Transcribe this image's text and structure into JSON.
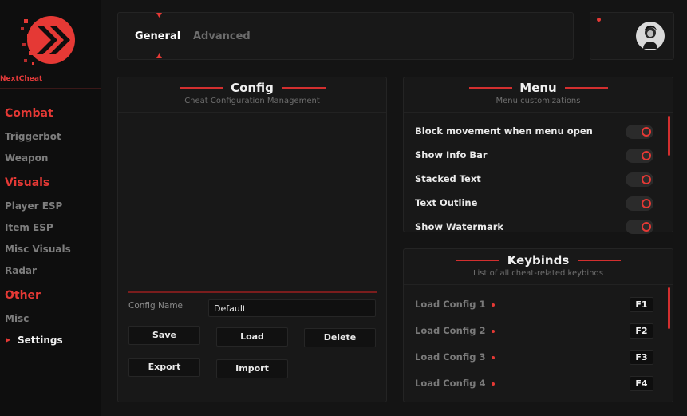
{
  "brand": {
    "name": "NextCheat",
    "accent": "#e53935"
  },
  "sidebar": {
    "sections": [
      {
        "title": "Combat",
        "items": [
          "Triggerbot",
          "Weapon"
        ]
      },
      {
        "title": "Visuals",
        "items": [
          "Player ESP",
          "Item ESP",
          "Misc Visuals",
          "Radar"
        ]
      },
      {
        "title": "Other",
        "items": [
          "Misc",
          "Settings"
        ]
      }
    ],
    "active_item": "Settings"
  },
  "tabs": [
    {
      "label": "General",
      "active": true
    },
    {
      "label": "Advanced",
      "active": false
    }
  ],
  "config": {
    "title": "Config",
    "subtitle": "Cheat Configuration Management",
    "name_label": "Config Name",
    "name_value": "Default",
    "buttons": {
      "save": "Save",
      "load": "Load",
      "delete": "Delete",
      "export": "Export",
      "import": "Import"
    }
  },
  "menu": {
    "title": "Menu",
    "subtitle": "Menu customizations",
    "options": [
      {
        "label": "Block movement when menu open",
        "enabled": false
      },
      {
        "label": "Show Info Bar",
        "enabled": false
      },
      {
        "label": "Stacked Text",
        "enabled": false
      },
      {
        "label": "Text Outline",
        "enabled": false
      },
      {
        "label": "Show Watermark",
        "enabled": false
      }
    ]
  },
  "keybinds": {
    "title": "Keybinds",
    "subtitle": "List of all cheat-related keybinds",
    "items": [
      {
        "label": "Load Config 1",
        "key": "F1"
      },
      {
        "label": "Load Config 2",
        "key": "F2"
      },
      {
        "label": "Load Config 3",
        "key": "F3"
      },
      {
        "label": "Load Config 4",
        "key": "F4"
      }
    ]
  },
  "icons": {
    "logo": "double-chevron-logo",
    "avatar": "user-avatar",
    "toggle": "circle-knob",
    "indicator": "triangle"
  }
}
